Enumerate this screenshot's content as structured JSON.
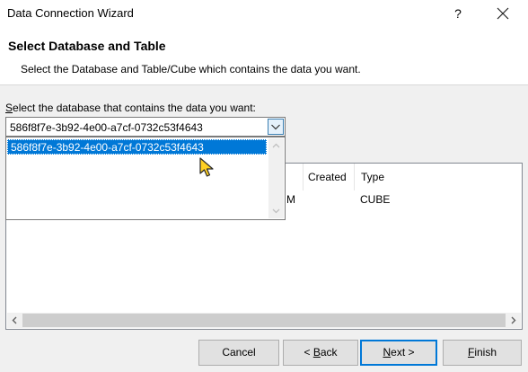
{
  "window": {
    "title": "Data Connection Wizard",
    "help": "?"
  },
  "header": {
    "title": "Select Database and Table",
    "subtitle": "Select the Database and Table/Cube which contains the data you want."
  },
  "database": {
    "label_first": "S",
    "label_rest": "elect the database that contains the data you want:",
    "selected": "586f8f7e-3b92-4e00-a7cf-0732c53f4643",
    "options": [
      "586f8f7e-3b92-4e00-a7cf-0732c53f4643"
    ]
  },
  "table": {
    "columns": {
      "created": "Created",
      "type": "Type"
    },
    "rows": [
      {
        "name_tail": "M",
        "type": "CUBE"
      }
    ]
  },
  "buttons": {
    "cancel": "Cancel",
    "back_prefix": "< ",
    "back_mnemonic": "B",
    "back_rest": "ack",
    "next_mnemonic": "N",
    "next_rest": "ext >",
    "finish_mnemonic": "F",
    "finish_rest": "inish"
  },
  "colors": {
    "accent": "#0078d7",
    "selection_bg": "#0078d7"
  }
}
